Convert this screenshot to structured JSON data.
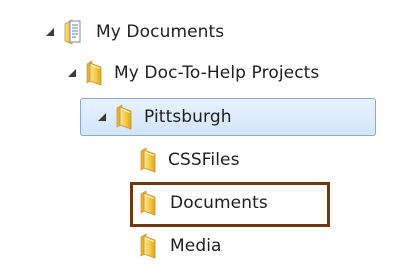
{
  "tree": {
    "nodes": [
      {
        "label": "My Documents",
        "icon": "document-folder-icon",
        "expanded": true
      },
      {
        "label": "My Doc-To-Help Projects",
        "icon": "folder-icon",
        "expanded": true
      },
      {
        "label": "Pittsburgh",
        "icon": "folder-icon",
        "expanded": true,
        "selected": true
      },
      {
        "label": "CSSFiles",
        "icon": "folder-icon"
      },
      {
        "label": "Documents",
        "icon": "folder-icon",
        "highlighted": true
      },
      {
        "label": "Media",
        "icon": "folder-icon"
      }
    ]
  },
  "colors": {
    "selection_border": "#84acdd",
    "selection_fill": "#d3e5fb",
    "highlight_frame": "#6b3a14",
    "folder_yellow": "#f5c93e",
    "expander_arrow": "#3c3c3c"
  }
}
